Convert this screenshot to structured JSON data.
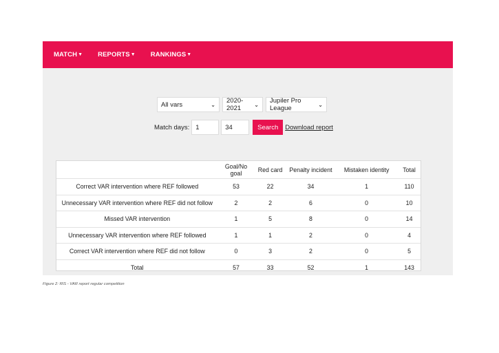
{
  "nav": {
    "items": [
      {
        "label": "MATCH"
      },
      {
        "label": "REPORTS"
      },
      {
        "label": "RANKINGS"
      }
    ]
  },
  "filters": {
    "vars": "All vars",
    "season": "2020-2021",
    "league": "Jupiler Pro League"
  },
  "match_days": {
    "label": "Match days:",
    "from": "1",
    "to": "34",
    "search_label": "Search",
    "download_label": "Download report"
  },
  "table": {
    "headers": [
      "",
      "Goal/No goal",
      "Red card",
      "Penalty incident",
      "Mistaken identity",
      "Total"
    ],
    "rows": [
      {
        "label": "Correct VAR intervention where REF followed",
        "cells": [
          "53",
          "22",
          "34",
          "1",
          "110"
        ]
      },
      {
        "label": "Unnecessary VAR intervention where REF did not follow",
        "cells": [
          "2",
          "2",
          "6",
          "0",
          "10"
        ]
      },
      {
        "label": "Missed VAR intervention",
        "cells": [
          "1",
          "5",
          "8",
          "0",
          "14"
        ]
      },
      {
        "label": "Unnecessary VAR intervention where REF followed",
        "cells": [
          "1",
          "1",
          "2",
          "0",
          "4"
        ]
      },
      {
        "label": "Correct VAR intervention where REF did not follow",
        "cells": [
          "0",
          "3",
          "2",
          "0",
          "5"
        ]
      },
      {
        "label": "Total",
        "cells": [
          "57",
          "33",
          "52",
          "1",
          "143"
        ]
      }
    ]
  },
  "caption": "Figure 2: RIS - VAR report regular competition",
  "colors": {
    "brand": "#e8114f",
    "panel": "#efefef"
  }
}
